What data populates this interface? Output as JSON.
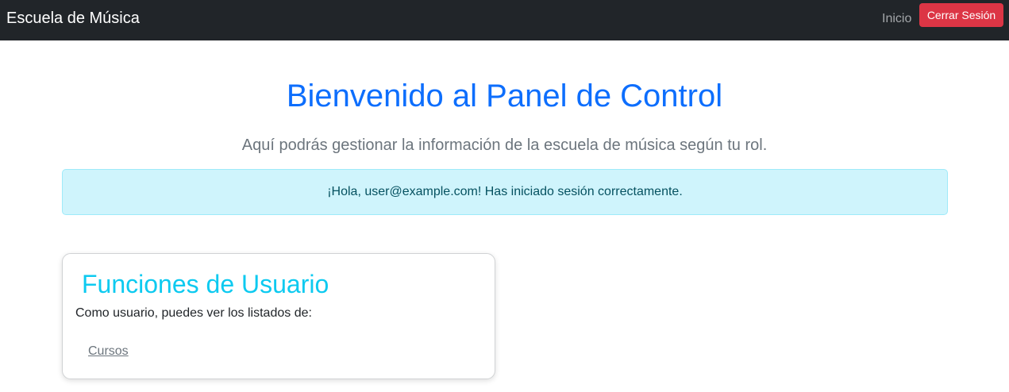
{
  "navbar": {
    "brand": "Escuela de Música",
    "links": [
      {
        "label": "Inicio"
      }
    ],
    "logout_label": "Cerrar Sesión"
  },
  "main": {
    "title": "Bienvenido al Panel de Control",
    "lead": "Aquí podrás gestionar la información de la escuela de música según tu rol.",
    "alert": "¡Hola, user@example.com! Has iniciado sesión correctamente."
  },
  "card": {
    "title": "Funciones de Usuario",
    "text": "Como usuario, puedes ver los listados de:",
    "links": [
      {
        "label": "Cursos"
      }
    ]
  },
  "colors": {
    "navbar_bg": "#212529",
    "primary": "#0d6efd",
    "danger": "#dc3545",
    "info": "#0dcaf0",
    "alert_bg": "#cff4fc",
    "alert_text": "#055160"
  }
}
